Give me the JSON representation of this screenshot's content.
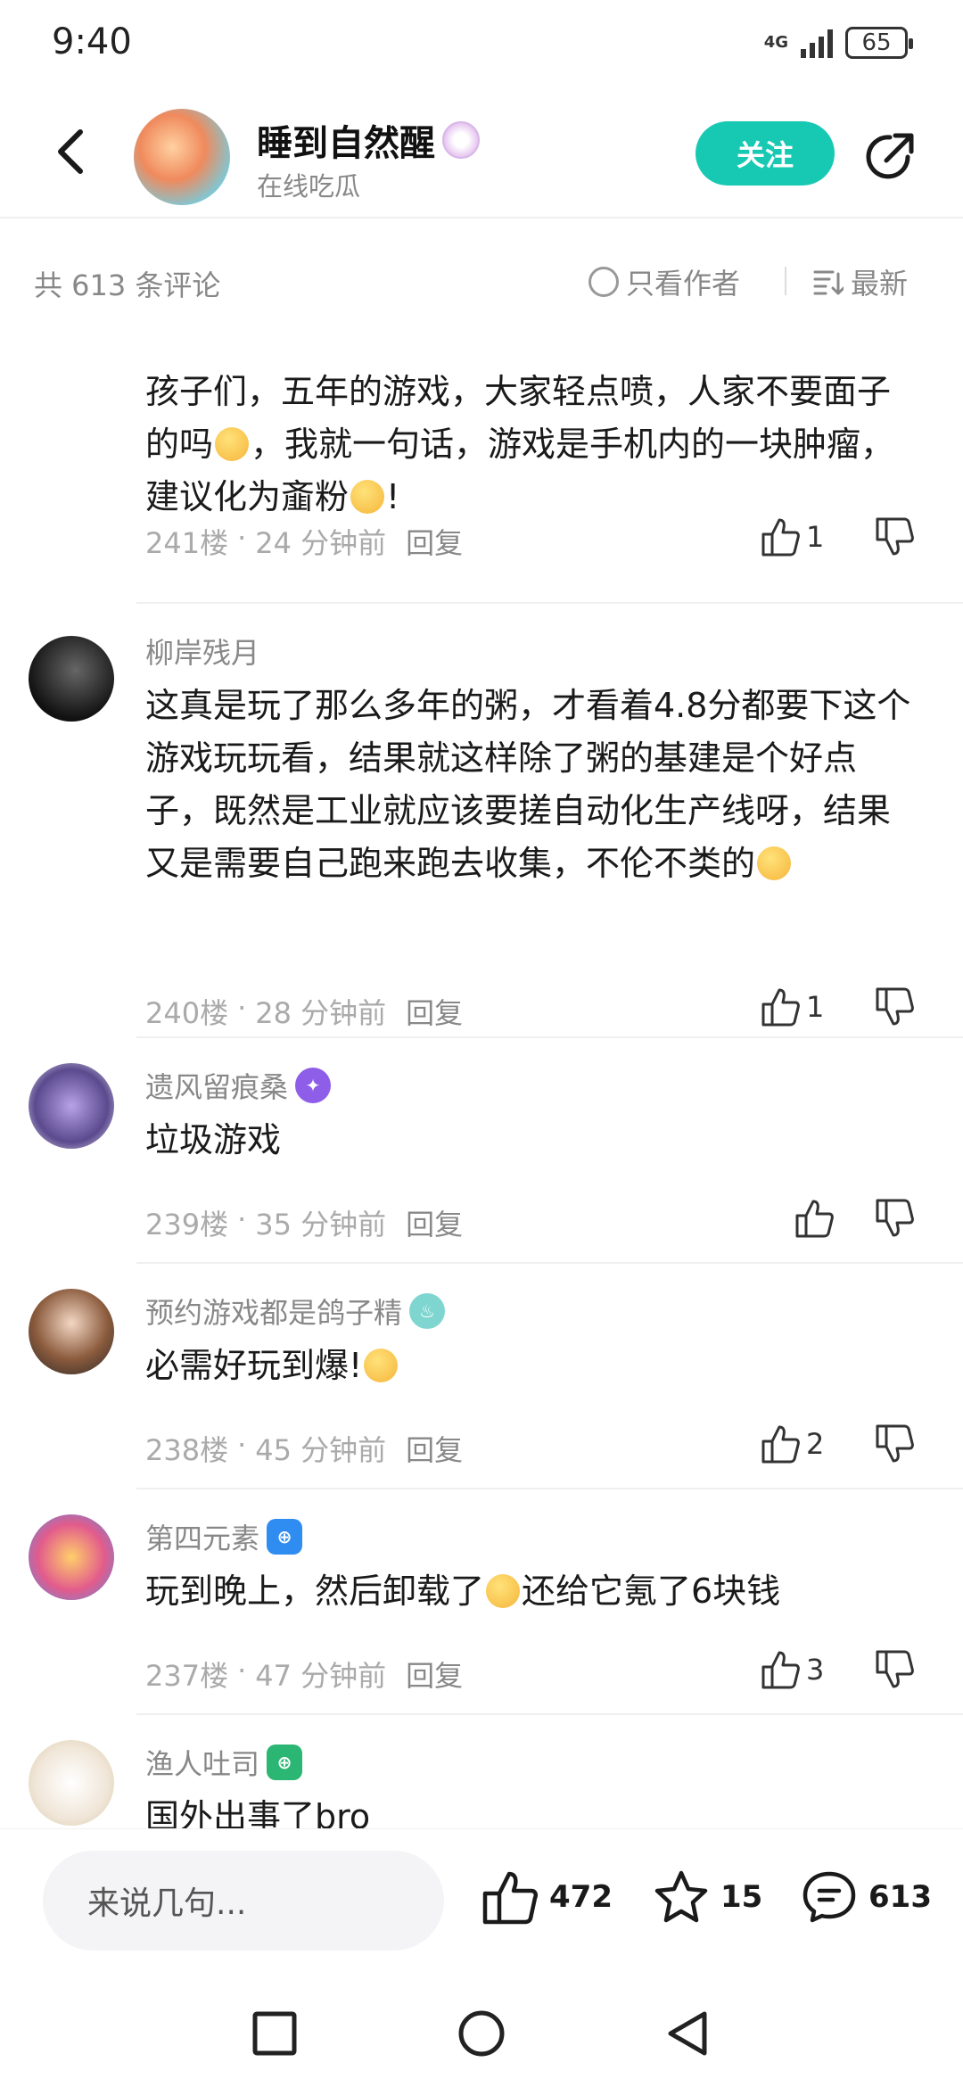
{
  "status": {
    "time": "9:40",
    "network": "4G",
    "battery": "65"
  },
  "header": {
    "name": "睡到自然醒",
    "subtitle": "在线吃瓜",
    "follow_label": "关注"
  },
  "filter": {
    "count_text": "共 613 条评论",
    "author_only_label": "只看作者",
    "sort_label": "最新"
  },
  "comments": [
    {
      "user": "",
      "text_parts": [
        "孩子们，五年的游戏，大家轻点喷，人家不要面子的吗",
        "，我就一句话，游戏是手机内的一块肿瘤，建议化为齑粉",
        "!"
      ],
      "floor": "241楼",
      "time": "24 分钟前",
      "reply": "回复",
      "likes": "1"
    },
    {
      "user": "柳岸残月",
      "text_parts": [
        "这真是玩了那么多年的粥，才看着4.8分都要下这个游戏玩玩看，结果就这样除了粥的基建是个好点子，既然是工业就应该要搓自动化生产线呀，结果又是需要自己跑来跑去收集，不伦不类的"
      ],
      "floor": "240楼",
      "time": "28 分钟前",
      "reply": "回复",
      "likes": "1"
    },
    {
      "user": "遗风留痕桑",
      "text_parts": [
        "垃圾游戏"
      ],
      "floor": "239楼",
      "time": "35 分钟前",
      "reply": "回复",
      "likes": ""
    },
    {
      "user": "预约游戏都是鸽子精",
      "text_parts": [
        "必需好玩到爆!"
      ],
      "floor": "238楼",
      "time": "45 分钟前",
      "reply": "回复",
      "likes": "2"
    },
    {
      "user": "第四元素",
      "text_parts": [
        "玩到晚上，然后卸载了",
        "还给它氪了6块钱"
      ],
      "floor": "237楼",
      "time": "47 分钟前",
      "reply": "回复",
      "likes": "3"
    },
    {
      "user": "渔人吐司",
      "text_parts": [
        "国外出事了bro"
      ],
      "floor": "",
      "time": "",
      "reply": "",
      "likes": ""
    }
  ],
  "bottom_bar": {
    "input_placeholder": "来说几句...",
    "likes": "472",
    "favorites": "15",
    "comments": "613"
  },
  "colors": {
    "accent": "#17c9b3",
    "meta_text": "#aaaaaa"
  }
}
